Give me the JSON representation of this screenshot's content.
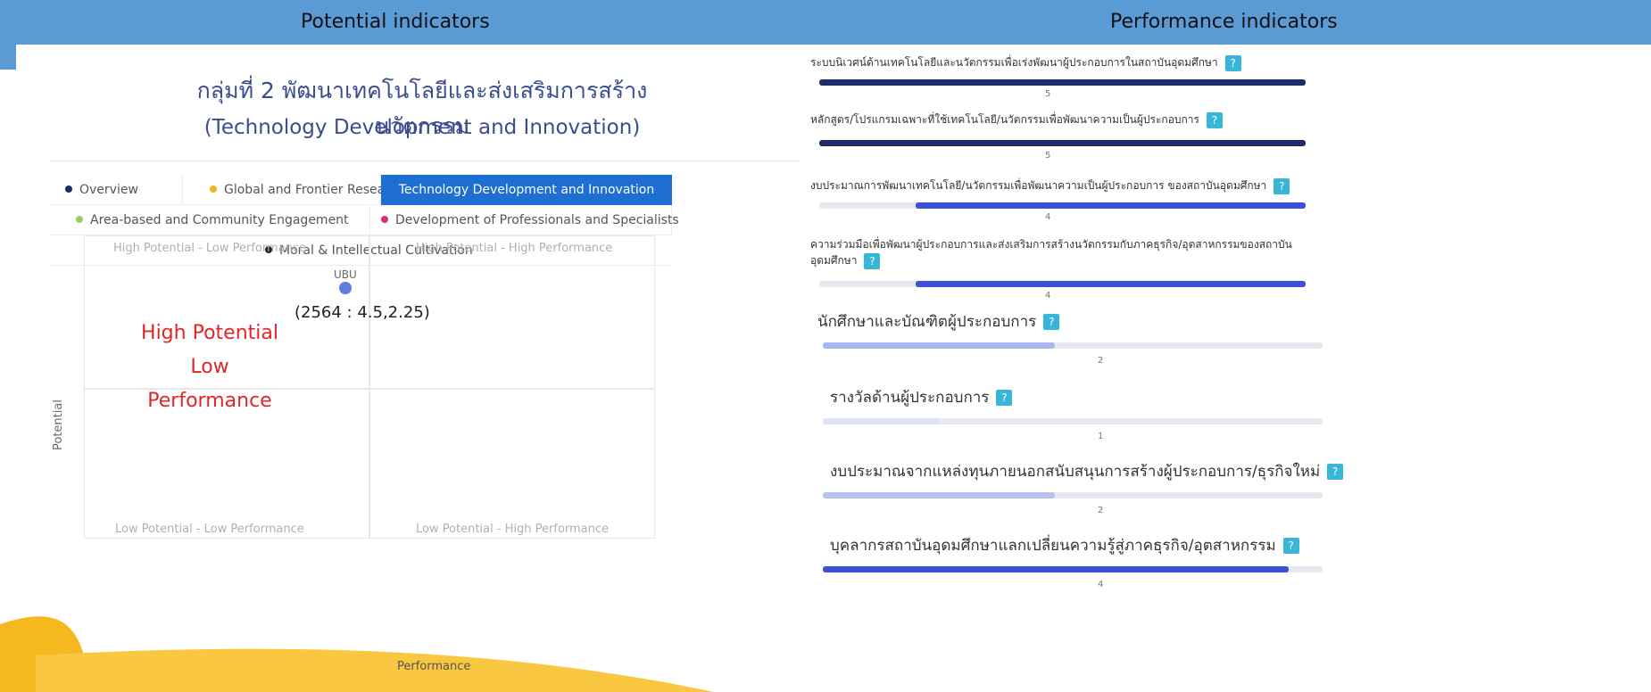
{
  "header": {
    "left_title": "Potential indicators",
    "right_title": "Performance indicators"
  },
  "left": {
    "title_th": "กลุ่มที่ 2 พัฒนาเทคโนโลยีและส่งเสริมการสร้างนวัตกรรม",
    "title_en": "(Technology Development and Innovation)",
    "tabs": [
      {
        "label": "Overview",
        "dot_color": "#1f2a6b",
        "active": false
      },
      {
        "label": "Global and Frontier Research",
        "dot_color": "#f5b21f",
        "active": false
      },
      {
        "label": "Technology Development and Innovation",
        "dot_color": "#1f6ed4",
        "active": true
      },
      {
        "label": "Area-based and Community Engagement",
        "dot_color": "#9ccc65",
        "active": false
      },
      {
        "label": "Development of Professionals and Specialists",
        "dot_color": "#d62e7a",
        "active": false
      },
      {
        "label": "Moral & Intellectual Cultivation",
        "dot_color": "#222222",
        "active": false
      }
    ],
    "chart": {
      "quadrants": {
        "top_left": "High Potential - Low Performance",
        "top_right": "High Potential - High Performance",
        "bottom_left": "Low Potential - Low Performance",
        "bottom_right": "Low Potential - High Performance"
      },
      "ylabel": "Potential",
      "xlabel": "Performance",
      "point": {
        "label": "UBU",
        "coords": "(2564 : 4.5,2.25)",
        "color": "#5b7fe0"
      },
      "annotation_line1": "High Potential",
      "annotation_line2": "Low Performance"
    }
  },
  "right": {
    "indicators": [
      {
        "label": "ระบบนิเวศน์ด้านเทคโนโลยีและนวัตกรรมเพื่อเร่งพัฒนาผู้ประกอบการในสถาบันอุดมศึกษา",
        "value": "5",
        "fill": 1.0
      },
      {
        "label": "หลักสูตร/โปรแกรมเฉพาะที่ใช้เทคโนโลยี/นวัตกรรมเพื่อพัฒนาความเป็นผู้ประกอบการ",
        "value": "5",
        "fill": 1.0
      },
      {
        "label": "งบประมาณการพัฒนาเทคโนโลยี/นวัตกรรมเพื่อพัฒนาความเป็นผู้ประกอบการ ของสถาบันอุดมศึกษา",
        "value": "4",
        "fill": 0.8
      },
      {
        "label_line1": "ความร่วมมือเพื่อพัฒนาผู้ประกอบการและส่งเสริมการสร้างนวัตกรรมกับภาคธุรกิจ/อุตสาหกรรมของสถาบัน",
        "label_line2": "อุดมศึกษา",
        "value": "4",
        "fill": 0.8
      },
      {
        "label": "นักศึกษาและบัณฑิตผู้ประกอบการ",
        "value": "2",
        "fill": 0.4
      },
      {
        "label": "รางวัลด้านผู้ประกอบการ",
        "value": "1",
        "fill": 0.2
      },
      {
        "label": "งบประมาณจากแหล่งทุนภายนอกสนับสนุนการสร้างผู้ประกอบการ/ธุรกิจใหม่",
        "value": "2",
        "fill": 0.4
      },
      {
        "label": "บุคลากรสถาบันอุดมศึกษาแลกเปลี่ยนความรู้สู่ภาคธุรกิจ/อุตสาหกรรม",
        "value": "4",
        "fill": 0.8
      }
    ],
    "help_glyph": "?",
    "bar_colors": {
      "dark": "#1f2a6b",
      "blue": "#3b4fd8",
      "light": "#b7c1ee"
    }
  }
}
